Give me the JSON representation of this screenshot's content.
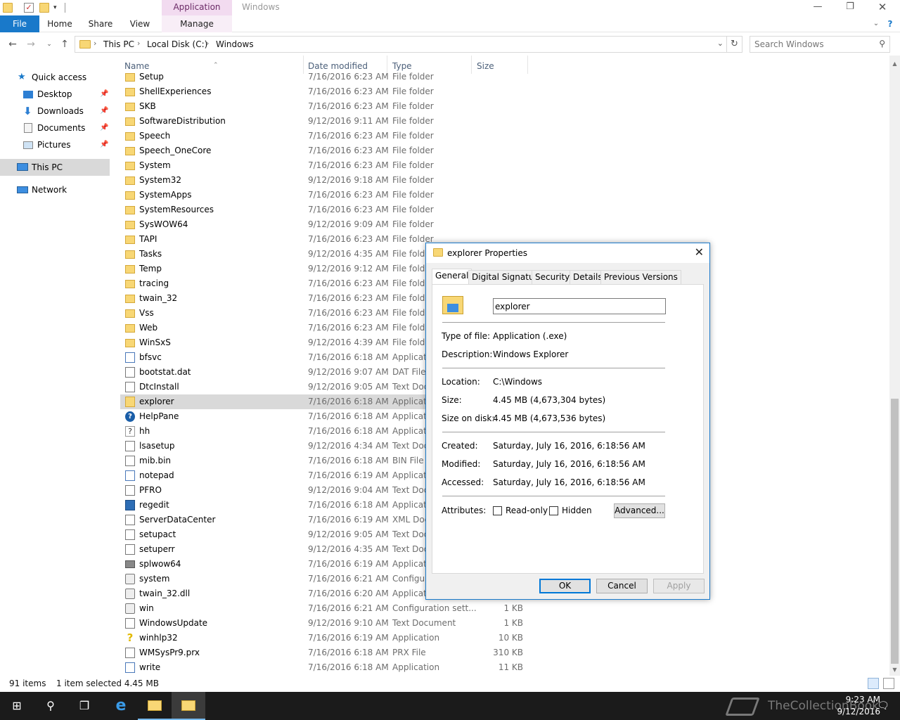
{
  "titlebar": {
    "context_tab": "Application Tools",
    "window_title": "Windows",
    "minimize": "—",
    "maximize": "❐",
    "close": "✕"
  },
  "ribbon": {
    "tabs": [
      "File",
      "Home",
      "Share",
      "View",
      "Manage"
    ]
  },
  "address": {
    "crumbs": [
      "This PC",
      "Local Disk (C:)",
      "Windows"
    ],
    "search_placeholder": "Search Windows"
  },
  "nav": {
    "items": [
      {
        "label": "Quick access"
      },
      {
        "label": "Desktop"
      },
      {
        "label": "Downloads"
      },
      {
        "label": "Documents"
      },
      {
        "label": "Pictures"
      },
      {
        "label": "This PC"
      },
      {
        "label": "Network"
      }
    ]
  },
  "columns": {
    "name": "Name",
    "date": "Date modified",
    "type": "Type",
    "size": "Size"
  },
  "files": [
    {
      "name": "Setup",
      "date": "7/16/2016 6:23 AM",
      "type": "File folder",
      "size": "",
      "icon": "folder"
    },
    {
      "name": "ShellExperiences",
      "date": "7/16/2016 6:23 AM",
      "type": "File folder",
      "size": "",
      "icon": "folder"
    },
    {
      "name": "SKB",
      "date": "7/16/2016 6:23 AM",
      "type": "File folder",
      "size": "",
      "icon": "folder"
    },
    {
      "name": "SoftwareDistribution",
      "date": "9/12/2016 9:11 AM",
      "type": "File folder",
      "size": "",
      "icon": "folder"
    },
    {
      "name": "Speech",
      "date": "7/16/2016 6:23 AM",
      "type": "File folder",
      "size": "",
      "icon": "folder"
    },
    {
      "name": "Speech_OneCore",
      "date": "7/16/2016 6:23 AM",
      "type": "File folder",
      "size": "",
      "icon": "folder"
    },
    {
      "name": "System",
      "date": "7/16/2016 6:23 AM",
      "type": "File folder",
      "size": "",
      "icon": "folder"
    },
    {
      "name": "System32",
      "date": "9/12/2016 9:18 AM",
      "type": "File folder",
      "size": "",
      "icon": "folder"
    },
    {
      "name": "SystemApps",
      "date": "7/16/2016 6:23 AM",
      "type": "File folder",
      "size": "",
      "icon": "folder"
    },
    {
      "name": "SystemResources",
      "date": "7/16/2016 6:23 AM",
      "type": "File folder",
      "size": "",
      "icon": "folder"
    },
    {
      "name": "SysWOW64",
      "date": "9/12/2016 9:09 AM",
      "type": "File folder",
      "size": "",
      "icon": "folder"
    },
    {
      "name": "TAPI",
      "date": "7/16/2016 6:23 AM",
      "type": "File folder",
      "size": "",
      "icon": "folder"
    },
    {
      "name": "Tasks",
      "date": "9/12/2016 4:35 AM",
      "type": "File folde",
      "size": "",
      "icon": "folder"
    },
    {
      "name": "Temp",
      "date": "9/12/2016 9:12 AM",
      "type": "File folde",
      "size": "",
      "icon": "folder"
    },
    {
      "name": "tracing",
      "date": "7/16/2016 6:23 AM",
      "type": "File folde",
      "size": "",
      "icon": "folder"
    },
    {
      "name": "twain_32",
      "date": "7/16/2016 6:23 AM",
      "type": "File folde",
      "size": "",
      "icon": "folder"
    },
    {
      "name": "Vss",
      "date": "7/16/2016 6:23 AM",
      "type": "File folde",
      "size": "",
      "icon": "folder"
    },
    {
      "name": "Web",
      "date": "7/16/2016 6:23 AM",
      "type": "File folde",
      "size": "",
      "icon": "folder"
    },
    {
      "name": "WinSxS",
      "date": "9/12/2016 4:39 AM",
      "type": "File folde",
      "size": "",
      "icon": "folder"
    },
    {
      "name": "bfsvc",
      "date": "7/16/2016 6:18 AM",
      "type": "Applicati",
      "size": "",
      "icon": "app"
    },
    {
      "name": "bootstat.dat",
      "date": "9/12/2016 9:07 AM",
      "type": "DAT File",
      "size": "",
      "icon": "doc"
    },
    {
      "name": "DtcInstall",
      "date": "9/12/2016 9:05 AM",
      "type": "Text Docu",
      "size": "",
      "icon": "doc"
    },
    {
      "name": "explorer",
      "date": "7/16/2016 6:18 AM",
      "type": "Applicati",
      "size": "",
      "icon": "explorer",
      "selected": true
    },
    {
      "name": "HelpPane",
      "date": "7/16/2016 6:18 AM",
      "type": "Applicati",
      "size": "",
      "icon": "help"
    },
    {
      "name": "hh",
      "date": "7/16/2016 6:18 AM",
      "type": "Applicati",
      "size": "",
      "icon": "hh"
    },
    {
      "name": "lsasetup",
      "date": "9/12/2016 4:34 AM",
      "type": "Text Docu",
      "size": "",
      "icon": "doc"
    },
    {
      "name": "mib.bin",
      "date": "7/16/2016 6:18 AM",
      "type": "BIN File",
      "size": "",
      "icon": "doc"
    },
    {
      "name": "notepad",
      "date": "7/16/2016 6:19 AM",
      "type": "Applicati",
      "size": "",
      "icon": "app"
    },
    {
      "name": "PFRO",
      "date": "9/12/2016 9:04 AM",
      "type": "Text Docu",
      "size": "",
      "icon": "doc"
    },
    {
      "name": "regedit",
      "date": "7/16/2016 6:18 AM",
      "type": "Applicati",
      "size": "",
      "icon": "regedit"
    },
    {
      "name": "ServerDataCenter",
      "date": "7/16/2016 6:19 AM",
      "type": "XML Doc",
      "size": "",
      "icon": "doc"
    },
    {
      "name": "setupact",
      "date": "9/12/2016 9:05 AM",
      "type": "Text Docu",
      "size": "",
      "icon": "doc"
    },
    {
      "name": "setuperr",
      "date": "9/12/2016 4:35 AM",
      "type": "Text Docu",
      "size": "",
      "icon": "doc"
    },
    {
      "name": "splwow64",
      "date": "7/16/2016 6:19 AM",
      "type": "Applicati",
      "size": "",
      "icon": "printer"
    },
    {
      "name": "system",
      "date": "7/16/2016 6:21 AM",
      "type": "Configur",
      "size": "",
      "icon": "gear"
    },
    {
      "name": "twain_32.dll",
      "date": "7/16/2016 6:20 AM",
      "type": "Applicati",
      "size": "",
      "icon": "gear"
    },
    {
      "name": "win",
      "date": "7/16/2016 6:21 AM",
      "type": "Configuration sett...",
      "size": "1 KB",
      "icon": "gear"
    },
    {
      "name": "WindowsUpdate",
      "date": "9/12/2016 9:10 AM",
      "type": "Text Document",
      "size": "1 KB",
      "icon": "doc"
    },
    {
      "name": "winhlp32",
      "date": "7/16/2016 6:19 AM",
      "type": "Application",
      "size": "10 KB",
      "icon": "yq"
    },
    {
      "name": "WMSysPr9.prx",
      "date": "7/16/2016 6:18 AM",
      "type": "PRX File",
      "size": "310 KB",
      "icon": "doc"
    },
    {
      "name": "write",
      "date": "7/16/2016 6:18 AM",
      "type": "Application",
      "size": "11 KB",
      "icon": "app"
    }
  ],
  "status": {
    "count": "91 items",
    "selected": "1 item selected  4.45 MB"
  },
  "dialog": {
    "title": "explorer Properties",
    "tabs": [
      "General",
      "Digital Signatures",
      "Security",
      "Details",
      "Previous Versions"
    ],
    "name_value": "explorer",
    "props": [
      {
        "label": "Type of file:",
        "value": "Application (.exe)"
      },
      {
        "label": "Description:",
        "value": "Windows Explorer"
      },
      {
        "label": "Location:",
        "value": "C:\\Windows"
      },
      {
        "label": "Size:",
        "value": "4.45 MB (4,673,304 bytes)"
      },
      {
        "label": "Size on disk:",
        "value": "4.45 MB (4,673,536 bytes)"
      },
      {
        "label": "Created:",
        "value": "Saturday, July 16, 2016, 6:18:56 AM"
      },
      {
        "label": "Modified:",
        "value": "Saturday, July 16, 2016, 6:18:56 AM"
      },
      {
        "label": "Accessed:",
        "value": "Saturday, July 16, 2016, 6:18:56 AM"
      }
    ],
    "attributes_label": "Attributes:",
    "readonly_label": "Read-only",
    "hidden_label": "Hidden",
    "advanced_label": "Advanced...",
    "ok_label": "OK",
    "cancel_label": "Cancel",
    "apply_label": "Apply"
  },
  "taskbar": {
    "time": "9:23 AM",
    "date": "9/12/2016",
    "watermark": "TheCollectionBook"
  }
}
